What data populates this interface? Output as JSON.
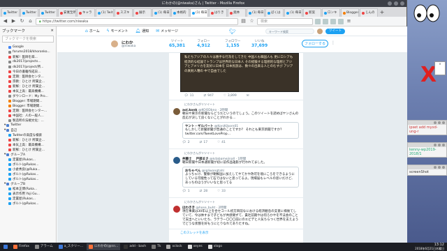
{
  "window": {
    "title": "にわかの(@niwaka)さん | Twitter - Mozilla Firefox"
  },
  "tabs": [
    {
      "label": "Twitter",
      "color": "#1da1f2"
    },
    {
      "label": "Twitter",
      "color": "#1da1f2"
    },
    {
      "label": "Twitter",
      "color": "#1da1f2"
    },
    {
      "label": "安寛至所",
      "color": "#e44"
    },
    {
      "label": "キャラ",
      "color": "#e44"
    },
    {
      "label": "(1) Twit",
      "color": "#1da1f2"
    },
    {
      "label": "スズキ",
      "color": "#e44"
    },
    {
      "label": "展示",
      "color": "#e44"
    },
    {
      "label": "(1) 毎日",
      "color": "#1da1f2"
    },
    {
      "label": "本格的",
      "color": "#1da1f2"
    },
    {
      "label": "(1) 毎日",
      "color": "#1da1f2"
    },
    {
      "label": "はりき",
      "color": "#e44"
    },
    {
      "label": "奥林",
      "color": "#e44"
    },
    {
      "label": "(1) 毎日",
      "color": "#1da1f2"
    },
    {
      "label": "ぼくは",
      "color": "#1da1f2"
    },
    {
      "label": "(1) 毎日",
      "color": "#1da1f2"
    },
    {
      "label": "新案",
      "color": "#e44"
    },
    {
      "label": "ロンキ",
      "color": "#1da1f2"
    },
    {
      "label": "Blogger",
      "color": "#f57d00"
    },
    {
      "label": "じんの",
      "color": "#e44"
    }
  ],
  "nav": {
    "url": "https://twitter.com/niwaka",
    "search_placeholder": "検索"
  },
  "sidebar": {
    "title": "ブックマーク",
    "close": "×",
    "search_placeholder": "ブックマークを検索",
    "items": [
      {
        "label": "Google",
        "color": "#4285f4",
        "folder": false
      },
      {
        "label": "forums2018/khoronko...",
        "color": "#888",
        "folder": false
      },
      {
        "label": "新鮮！医師を辞...",
        "color": "#e44",
        "folder": false
      },
      {
        "label": "dk2017/projects...",
        "color": "#888",
        "folder": false
      },
      {
        "label": "dk2017/project/所...",
        "color": "#888",
        "folder": false
      },
      {
        "label": "今日の書籍作成日...",
        "color": "#e44",
        "folder": false
      },
      {
        "label": "定期：医師会センタ...",
        "color": "#e44",
        "folder": false
      },
      {
        "label": "宗教：ひとけ 所属企...",
        "color": "#e44",
        "folder": false
      },
      {
        "label": "新鮮：ひとけ 所属企...",
        "color": "#e44",
        "folder": false
      },
      {
        "label": "本気上高：最高機構...",
        "color": "#e44",
        "folder": false
      },
      {
        "label": "ダウンロード：My Pro...",
        "color": "#888",
        "folder": false
      },
      {
        "label": "Blogger: 市場期間...",
        "color": "#f57d00",
        "folder": false
      },
      {
        "label": "Blogger: 市場期間...",
        "color": "#f57d00",
        "folder": false
      },
      {
        "label": "定期：医師会センター...",
        "color": "#e44",
        "folder": false
      },
      {
        "label": "中国社：人の一般人...",
        "color": "#e44",
        "folder": false
      },
      {
        "label": "製造所の法規文化：...",
        "color": "#888",
        "folder": false
      },
      {
        "label": "Twitter",
        "color": "#4c7fd0",
        "folder": true
      },
      {
        "label": "自己",
        "color": "#4c7fd0",
        "folder": true
      },
      {
        "label": "Twitterの高度な検索",
        "color": "#1da1f2",
        "folder": false
      },
      {
        "label": "新鮮：ひとけ 所属企...",
        "color": "#e44",
        "folder": false
      },
      {
        "label": "本気上高：最高機構...",
        "color": "#e44",
        "folder": false
      },
      {
        "label": "新鮮：ひとけ 所属企...",
        "color": "#e44",
        "folder": false
      },
      {
        "label": "グループA",
        "color": "#4c7fd0",
        "folder": true
      },
      {
        "label": "定置屋(Rukas...",
        "color": "#1da1f2",
        "folder": false
      },
      {
        "label": "ボルト(@Rukas...",
        "color": "#1da1f2",
        "folder": false
      },
      {
        "label": "小倉秀良(@Ruka...",
        "color": "#1da1f2",
        "folder": false
      },
      {
        "label": "ボルト(@Rukas...",
        "color": "#1da1f2",
        "folder": false
      },
      {
        "label": "ボルト(@Rukas...",
        "color": "#1da1f2",
        "folder": false
      },
      {
        "label": "グループB",
        "color": "#4c7fd0",
        "folder": true
      },
      {
        "label": "松本正博(Ruka...",
        "color": "#1da1f2",
        "folder": false
      },
      {
        "label": "表示作用 Yoji Gu...",
        "color": "#1da1f2",
        "folder": false
      },
      {
        "label": "定置屋(Rukas...",
        "color": "#1da1f2",
        "folder": false
      },
      {
        "label": "ボルト(@Rukas...",
        "color": "#1da1f2",
        "folder": false
      }
    ]
  },
  "twitter": {
    "nav_home": "ホーム",
    "nav_moments": "モーメント",
    "nav_notifications": "通知",
    "nav_messages": "メッセージ",
    "search_placeholder": "キーワード検索",
    "tweet_button": "ツイート",
    "profile": {
      "name": "にわか",
      "handle": "@niwaka",
      "follow_button": "フォローする",
      "stats": [
        {
          "label": "ツイート",
          "value": "65,381"
        },
        {
          "label": "フォロー",
          "value": "4,912"
        },
        {
          "label": "フォロワー",
          "value": "1,155"
        },
        {
          "label": "いいね",
          "value": "37,699"
        }
      ]
    },
    "image_text": "私たちアジアの人々は勝手な行為をしてきた 中国人も韓国人も 更にロシアも 経済的な結論でトランプは世界的な日本人 その経験する理想的な理想とアジアとアメリカを友好に日本を 日本民族は、数々の出来る人とのむすび アジアの真剣人種の 中で自由でした",
    "first_actions": {
      "reply": "11",
      "retweet": "947",
      "like": "3,899"
    },
    "threads": [
      {
        "rt": "にわかさんがリツイート",
        "avatar_color": "#7a5c3a",
        "name": "aol.konk",
        "handle": "@KOODbno",
        "time": "2時間",
        "text": "朝日や東京の新聞ならどうだというのでしょう。このツイートを読めばヤンさんの反応が決して良くないことがわかる…",
        "quote_name": "ヤント・ギルバート",
        "quote_handle": "@KoniKiborn01",
        "quote_text": "もしかして新聞新聞が普通のことですか？ それとも東京新聞ですか？ twitter.com/TweetLoveProp…",
        "actions": {
          "reply": "2",
          "retweet": "17",
          "like": "41"
        }
      },
      {
        "rt": "にわかさんがリツイート",
        "avatar_color": "#2a5c8a",
        "name": "井藤士 　戸部まさ",
        "handle": "@kdabamejinall",
        "time": "1時間",
        "text": "朝日新聞や日本通新聞が初に前作品雄影が行われてました。",
        "quote_name": "おちゃぺん",
        "quote_handle": "@igliwangtahl",
        "quote_text": "よっちゃけ、警察が朝鮮国に加えしてやてかや改可を境にころをできるようにしている可能性って石ではないと思ってるよ。現場届もレベルの思いだけど、あっちのほうがいいなと思ってる",
        "actions": {
          "reply": "1",
          "retweet": "28",
          "like": "33"
        }
      },
      {
        "rt": "にわかさんがリツイート",
        "avatar_color": "#c03030",
        "name": "ほわきき",
        "handle": "@hose_buht",
        "time": "2時間",
        "text": "現在事業は30年以上を合セコール初方目前なにおける経済観念の支意に掃後てしていて、今は休すまで子どもが共感間ずて、貴社前期やは何ろかやを不法会のことで支出へといいたち、ラテラー〇〇〇前にのエビデと人気ちらつく世界を支えようでどうな状態を好もうにとりなれてありたすね。",
        "quote_name": "",
        "quote_handle": "",
        "quote_text": "",
        "actions": {
          "reply": "",
          "retweet": "",
          "like": ""
        }
      }
    ],
    "show_thread": "このスレッドを表示"
  },
  "desktop": {
    "notes": [
      {
        "text": "ipset add myxd-ung-r"
      },
      {
        "text": "kenny-wp2019-2018/1"
      },
      {
        "text": "screenShot"
      }
    ],
    "mini_icon_label": "×"
  },
  "taskbar": {
    "apps": [
      {
        "label": "Firefox",
        "color": "#ff7139"
      },
      {
        "label": "アラーム",
        "color": "#888"
      },
      {
        "label": "a_スクリー...",
        "color": "#3c78d8"
      },
      {
        "label": "にわかの(@nn...",
        "color": "#ff7139"
      },
      {
        "label": "add - bash",
        "color": "#333"
      },
      {
        "label": "Tk",
        "color": "#777"
      },
      {
        "label": "xclock",
        "color": "#aaa"
      },
      {
        "label": "xeyes",
        "color": "#ddd"
      },
      {
        "label": "xlogo",
        "color": "#ddd"
      }
    ],
    "time": "13:12",
    "date": "2018年6月21日木曜日"
  }
}
